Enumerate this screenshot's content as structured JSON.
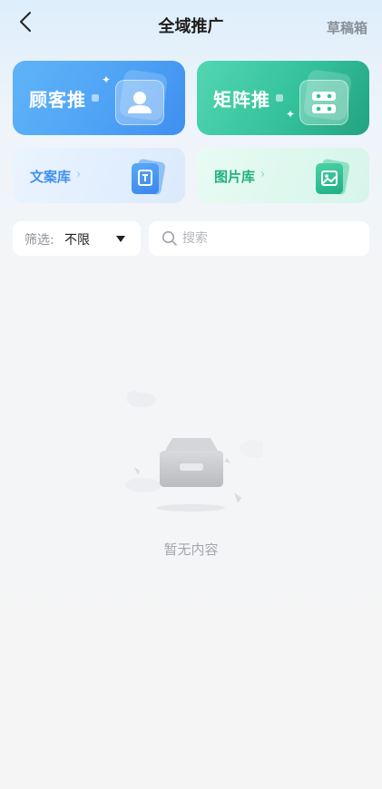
{
  "header": {
    "title": "全域推广",
    "drafts_label": "草稿箱"
  },
  "cards": {
    "customer": {
      "label": "顾客推",
      "icon": "person-icon"
    },
    "matrix": {
      "label": "矩阵推",
      "icon": "matrix-grid-icon"
    },
    "copy_library": {
      "label": "文案库",
      "icon": "document-stack-icon"
    },
    "image_library": {
      "label": "图片库",
      "icon": "image-stack-icon"
    }
  },
  "filter": {
    "label": "筛选:",
    "value": "不限"
  },
  "search": {
    "placeholder": "搜索",
    "value": ""
  },
  "empty_state": {
    "text": "暂无内容",
    "icon": "empty-box-icon"
  },
  "colors": {
    "blue_accent": "#4fa3f5",
    "green_accent": "#34c29a",
    "muted_text": "#a3a7ae"
  }
}
